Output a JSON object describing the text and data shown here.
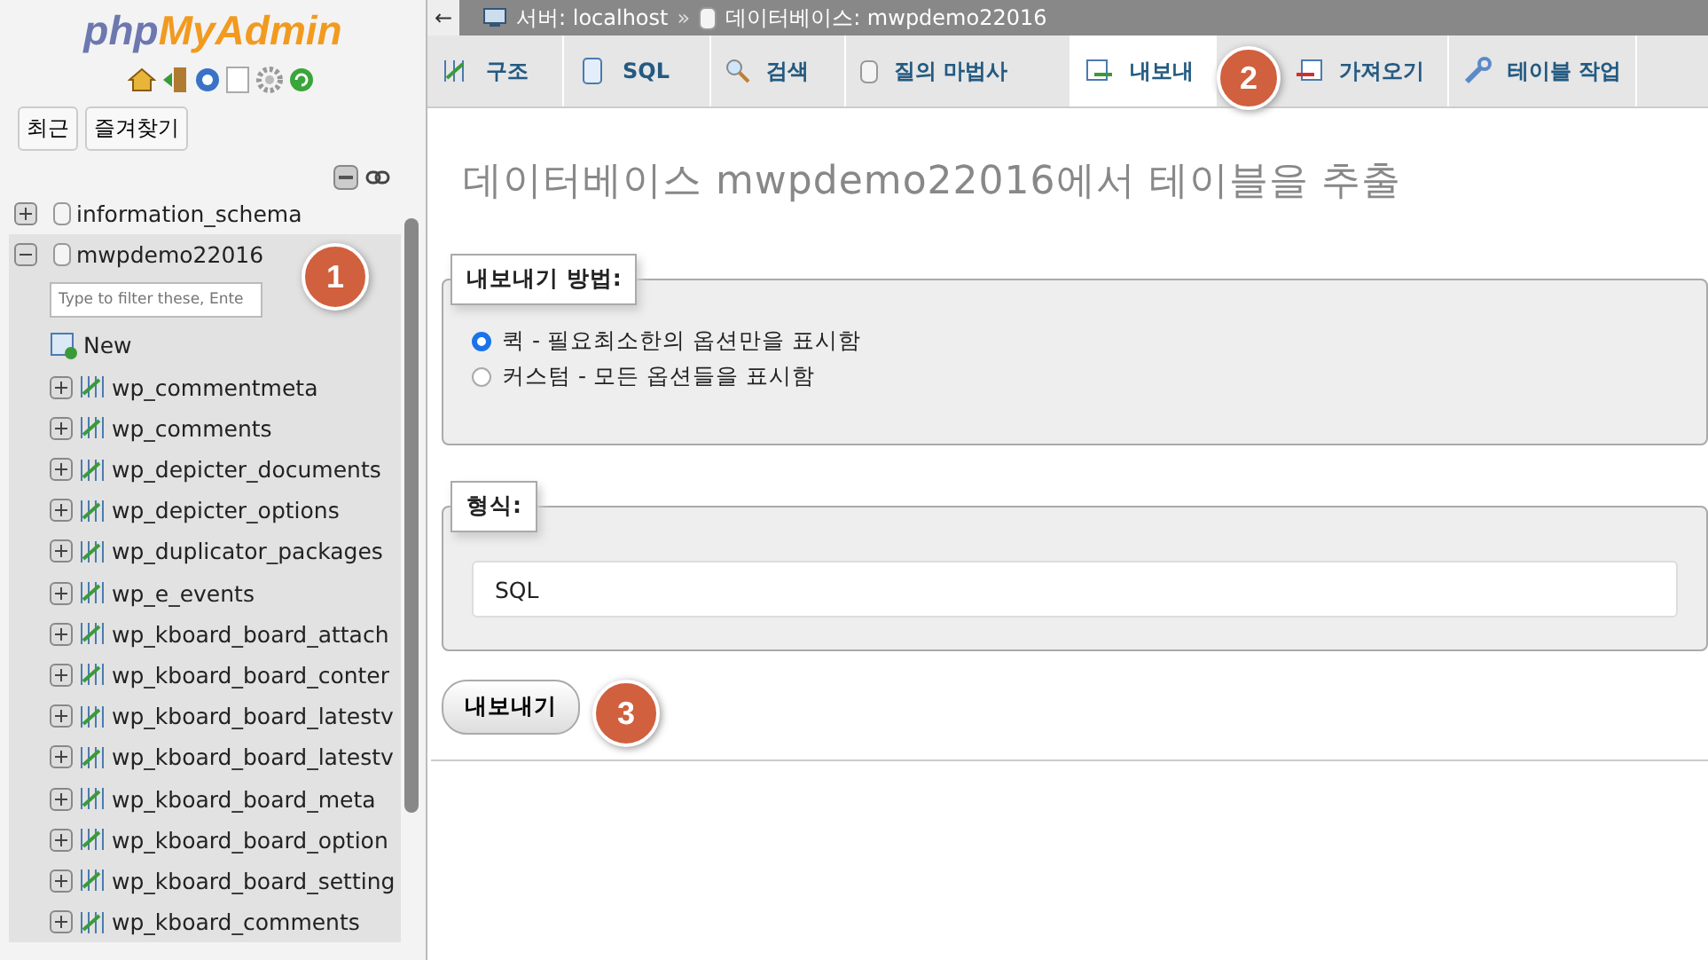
{
  "sidebar": {
    "logo": {
      "php": "php",
      "rest": "MyAdmin"
    },
    "buttons": [
      "최근",
      "즐겨찾기"
    ],
    "tree": [
      {
        "name": "information_schema",
        "expanded": false,
        "selected": false
      },
      {
        "name": "mwpdemo22016",
        "expanded": true,
        "selected": true,
        "children": [
          {
            "kind": "filter",
            "placeholder": "Type to filter these, Ente"
          },
          {
            "kind": "new",
            "name": "New"
          },
          {
            "kind": "table",
            "name": "wp_commentmeta"
          },
          {
            "kind": "table",
            "name": "wp_comments"
          },
          {
            "kind": "table",
            "name": "wp_depicter_documents"
          },
          {
            "kind": "table",
            "name": "wp_depicter_options"
          },
          {
            "kind": "table",
            "name": "wp_duplicator_packages"
          },
          {
            "kind": "table",
            "name": "wp_e_events"
          },
          {
            "kind": "table",
            "name": "wp_kboard_board_attach"
          },
          {
            "kind": "table",
            "name": "wp_kboard_board_conter"
          },
          {
            "kind": "table",
            "name": "wp_kboard_board_latestv"
          },
          {
            "kind": "table",
            "name": "wp_kboard_board_latestv"
          },
          {
            "kind": "table",
            "name": "wp_kboard_board_meta"
          },
          {
            "kind": "table",
            "name": "wp_kboard_board_option"
          },
          {
            "kind": "table",
            "name": "wp_kboard_board_setting"
          },
          {
            "kind": "table",
            "name": "wp_kboard_comments"
          }
        ]
      }
    ]
  },
  "breadcrumb": {
    "back": "←",
    "server": "서버: localhost",
    "separator": "»",
    "database": "데이터베이스: mwpdemo22016"
  },
  "tabs": [
    {
      "label": "구조",
      "selected": false
    },
    {
      "label": "SQL",
      "selected": false
    },
    {
      "label": "검색",
      "selected": false
    },
    {
      "label": "질의 마법사",
      "selected": false
    },
    {
      "label": "내보내",
      "selected": true
    },
    {
      "label": "가져오기",
      "selected": false
    },
    {
      "label": "테이블 작업",
      "selected": false
    }
  ],
  "heading": "데이터베이스 mwpdemo22016에서 테이블을 추출",
  "method": {
    "legend": "내보내기 방법:",
    "options": [
      {
        "label": "퀵 - 필요최소한의 옵션만을 표시함",
        "selected": true
      },
      {
        "label": "커스텀 - 모든 옵션들을 표시함",
        "selected": false
      }
    ]
  },
  "format": {
    "legend": "형식:",
    "value": "SQL"
  },
  "submit": "내보내기",
  "badges": [
    "1",
    "2",
    "3"
  ]
}
